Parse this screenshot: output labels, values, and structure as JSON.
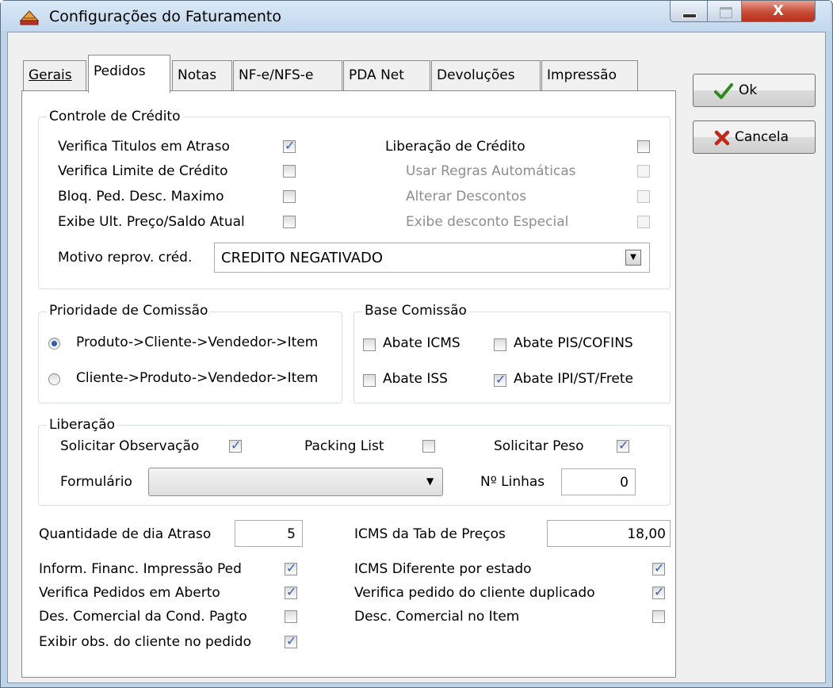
{
  "window": {
    "title": "Configurações do Faturamento",
    "close_glyph": "X"
  },
  "tabs": [
    "Gerais",
    "Pedidos",
    "Notas",
    "NF-e/NFS-e",
    "PDA Net",
    "Devoluções",
    "Impressão"
  ],
  "buttons": {
    "ok": "Ok",
    "cancel": "Cancela"
  },
  "credit": {
    "title": "Controle de Crédito",
    "verifica_titulos": "Verifica Titulos em Atraso",
    "verifica_limite": "Verifica Limite de Crédito",
    "bloq_ped": "Bloq. Ped. Desc. Maximo",
    "exibe_ult": "Exibe Ult. Preço/Saldo Atual",
    "liberacao": "Liberação de Crédito",
    "usar_regras": "Usar Regras Automáticas",
    "alterar_desc": "Alterar Descontos",
    "exibe_desc": "Exibe desconto Especial",
    "motivo_label": "Motivo reprov. créd.",
    "motivo_value": "CREDITO NEGATIVADO"
  },
  "commission": {
    "title": "Prioridade de Comissão",
    "opt1": "Produto->Cliente->Vendedor->Item",
    "opt2": "Cliente->Produto->Vendedor->Item"
  },
  "base": {
    "title": "Base Comissão",
    "abate_icms": "Abate ICMS",
    "abate_pis": "Abate PIS/COFINS",
    "abate_iss": "Abate ISS",
    "abate_ipi": "Abate IPI/ST/Frete"
  },
  "liberacao": {
    "title": "Liberação",
    "solicitar_obs": "Solicitar Observação",
    "packing": "Packing List",
    "solicitar_peso": "Solicitar Peso",
    "formulario": "Formulário",
    "linhas_label": "Nº Linhas",
    "linhas_value": "0"
  },
  "bottom": {
    "qtd_label": "Quantidade de dia Atraso",
    "qtd_value": "5",
    "icms_tab_label": "ICMS da Tab de Preços",
    "icms_tab_value": "18,00",
    "inform": "Inform. Financ. Impressão Ped",
    "verifica_pedidos": "Verifica Pedidos em Aberto",
    "des_comercial": "Des. Comercial da Cond. Pagto",
    "exibir_obs": "Exibir obs. do cliente no pedido",
    "icms_dif": "ICMS Diferente por estado",
    "verifica_dup": "Verifica pedido do cliente duplicado",
    "desc_item": "Desc. Comercial no Item"
  }
}
